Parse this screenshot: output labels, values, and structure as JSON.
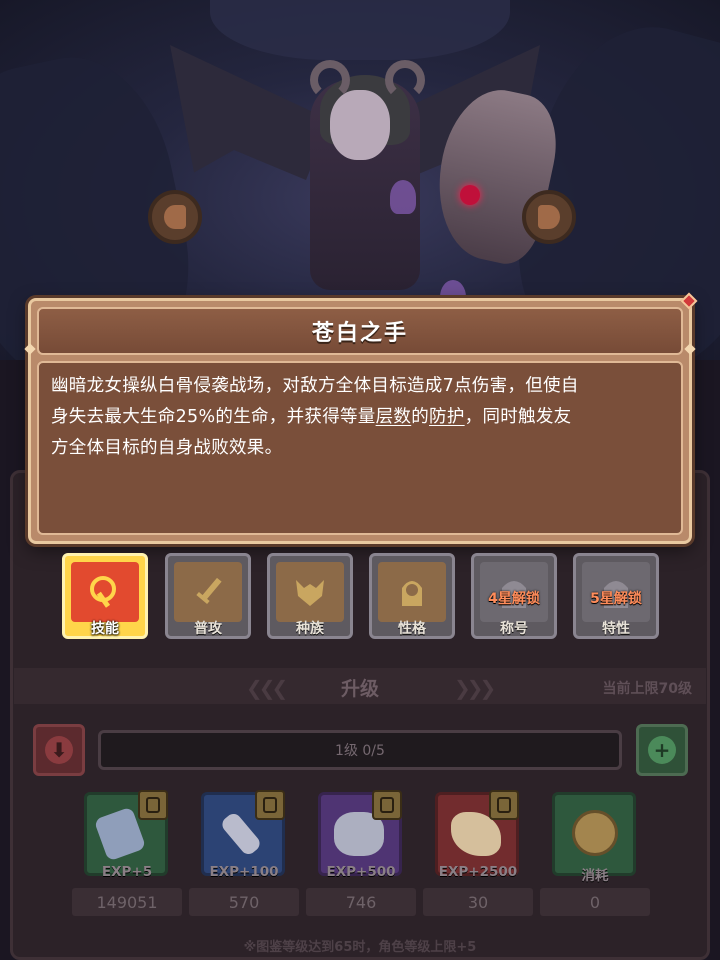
{
  "popup": {
    "title": "苍白之手",
    "description": {
      "line1": "幽暗龙女操纵白骨侵袭战场，对敌方全体目标造成7点伤害，但使自",
      "line2_pre": "身失去最大生命25%的生命，并获得等量",
      "line2_kw1": "层数",
      "line2_mid": "的",
      "line2_kw2": "防护",
      "line2_post": "，同时触发友",
      "line3": "方全体目标的自身战败效果。"
    }
  },
  "tabs": [
    {
      "label": "技能",
      "icon": "skill-icon",
      "active": true
    },
    {
      "label": "普攻",
      "icon": "sword-icon",
      "active": false
    },
    {
      "label": "种族",
      "icon": "race-icon",
      "active": false
    },
    {
      "label": "性格",
      "icon": "personality-icon",
      "active": false
    },
    {
      "label": "称号",
      "icon": "title-icon",
      "locked_text": "4星解锁"
    },
    {
      "label": "特性",
      "icon": "trait-icon",
      "locked_text": "5星解锁"
    }
  ],
  "upgrade": {
    "title": "升级",
    "limit": "当前上限70级",
    "level_text": "1级 0/5"
  },
  "items": [
    {
      "label": "EXP+5",
      "count": "149051",
      "color": "#2f6a45",
      "icon": "crystal-icon"
    },
    {
      "label": "EXP+100",
      "count": "570",
      "color": "#2c4e8e",
      "icon": "feather-icon"
    },
    {
      "label": "EXP+500",
      "count": "746",
      "color": "#5b3a8c",
      "icon": "stone-icon"
    },
    {
      "label": "EXP+2500",
      "count": "30",
      "color": "#8a3030",
      "icon": "scroll-icon"
    },
    {
      "label": "消耗",
      "count": "0",
      "color": "#2f6a45",
      "icon": "coin-icon"
    }
  ],
  "footnote": "※图鉴等级达到65时，角色等级上限+5",
  "colors": {
    "popup_bg": "#b98a6a",
    "popup_body": "#7a4f3a",
    "active_tab": "#ffd54a",
    "lock_text": "#ff8c5a"
  }
}
